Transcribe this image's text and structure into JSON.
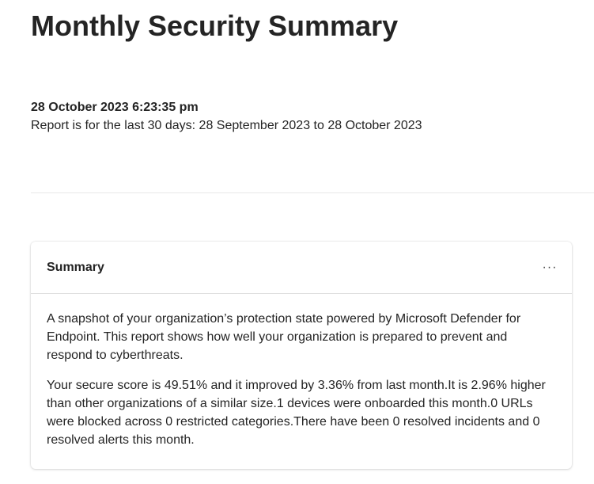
{
  "report": {
    "title": "Monthly Security Summary",
    "timestamp": "28 October 2023 6:23:35 pm",
    "range": "Report is for the last 30 days: 28 September 2023 to 28 October 2023"
  },
  "summary_card": {
    "title": "Summary",
    "more_label": "···",
    "paragraph_1": "A snapshot of your organization’s protection state powered by Microsoft Defender for Endpoint. This report shows how well your organization is prepared to prevent and respond to cyberthreats.",
    "paragraph_2": "Your secure score is 49.51% and it improved by 3.36% from last month.It is 2.96% higher than other organizations of a similar size.1 devices were onboarded this month.0 URLs were blocked across 0 restricted categories.There have been 0 resolved incidents and 0 resolved alerts this month."
  }
}
